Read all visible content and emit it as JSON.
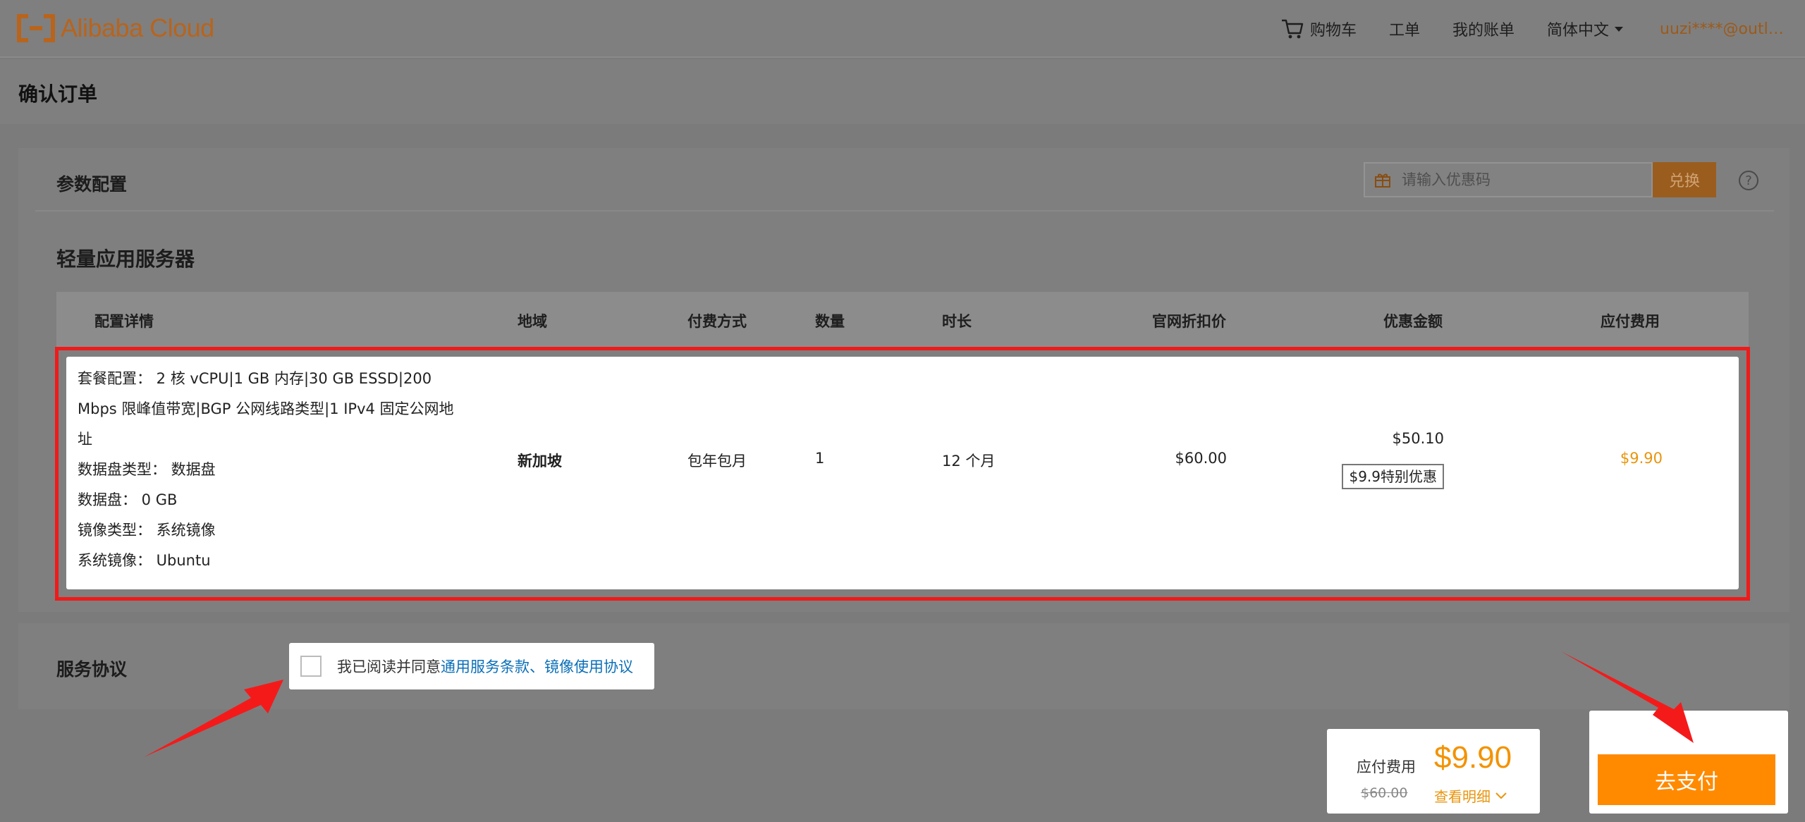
{
  "header": {
    "logo_text": "Alibaba Cloud",
    "nav": {
      "cart": "购物车",
      "ticket": "工单",
      "bill": "我的账单",
      "language": "简体中文",
      "user": "uuzi****@outlo..."
    }
  },
  "page_title": "确认订单",
  "config_section": {
    "label": "参数配置",
    "coupon_placeholder": "请输入优惠码",
    "redeem_label": "兑换",
    "help_symbol": "?"
  },
  "product": {
    "title": "轻量应用服务器",
    "columns": [
      "配置详情",
      "地域",
      "付费方式",
      "数量",
      "时长",
      "官网折扣价",
      "优惠金额",
      "应付费用"
    ],
    "details": [
      "套餐配置： 2 核 vCPU|1 GB 内存|30 GB ESSD|200",
      "Mbps 限峰值带宽|BGP 公网线路类型|1 IPv4 固定公网地",
      "址",
      "数据盘类型： 数据盘",
      "数据盘： 0 GB",
      "镜像类型： 系统镜像",
      "系统镜像： Ubuntu"
    ],
    "region": "新加坡",
    "billing": "包年包月",
    "quantity": "1",
    "duration": "12 个月",
    "list_price": "$60.00",
    "discount_amount": "$50.10",
    "discount_badge": "$9.9特别优惠",
    "payable": "$9.90"
  },
  "agreement": {
    "label": "服务协议",
    "text_prefix": "我已阅读并同意",
    "link_text": "通用服务条款、镜像使用协议"
  },
  "summary": {
    "label": "应付费用",
    "price": "$9.90",
    "original_price": "$60.00",
    "detail_link": "查看明细"
  },
  "pay_button": "去支付",
  "colors": {
    "accent_orange": "#ff8a00",
    "price_orange": "#f39200",
    "highlight_red": "#f01a1a",
    "link_blue": "#0a6fb8"
  }
}
